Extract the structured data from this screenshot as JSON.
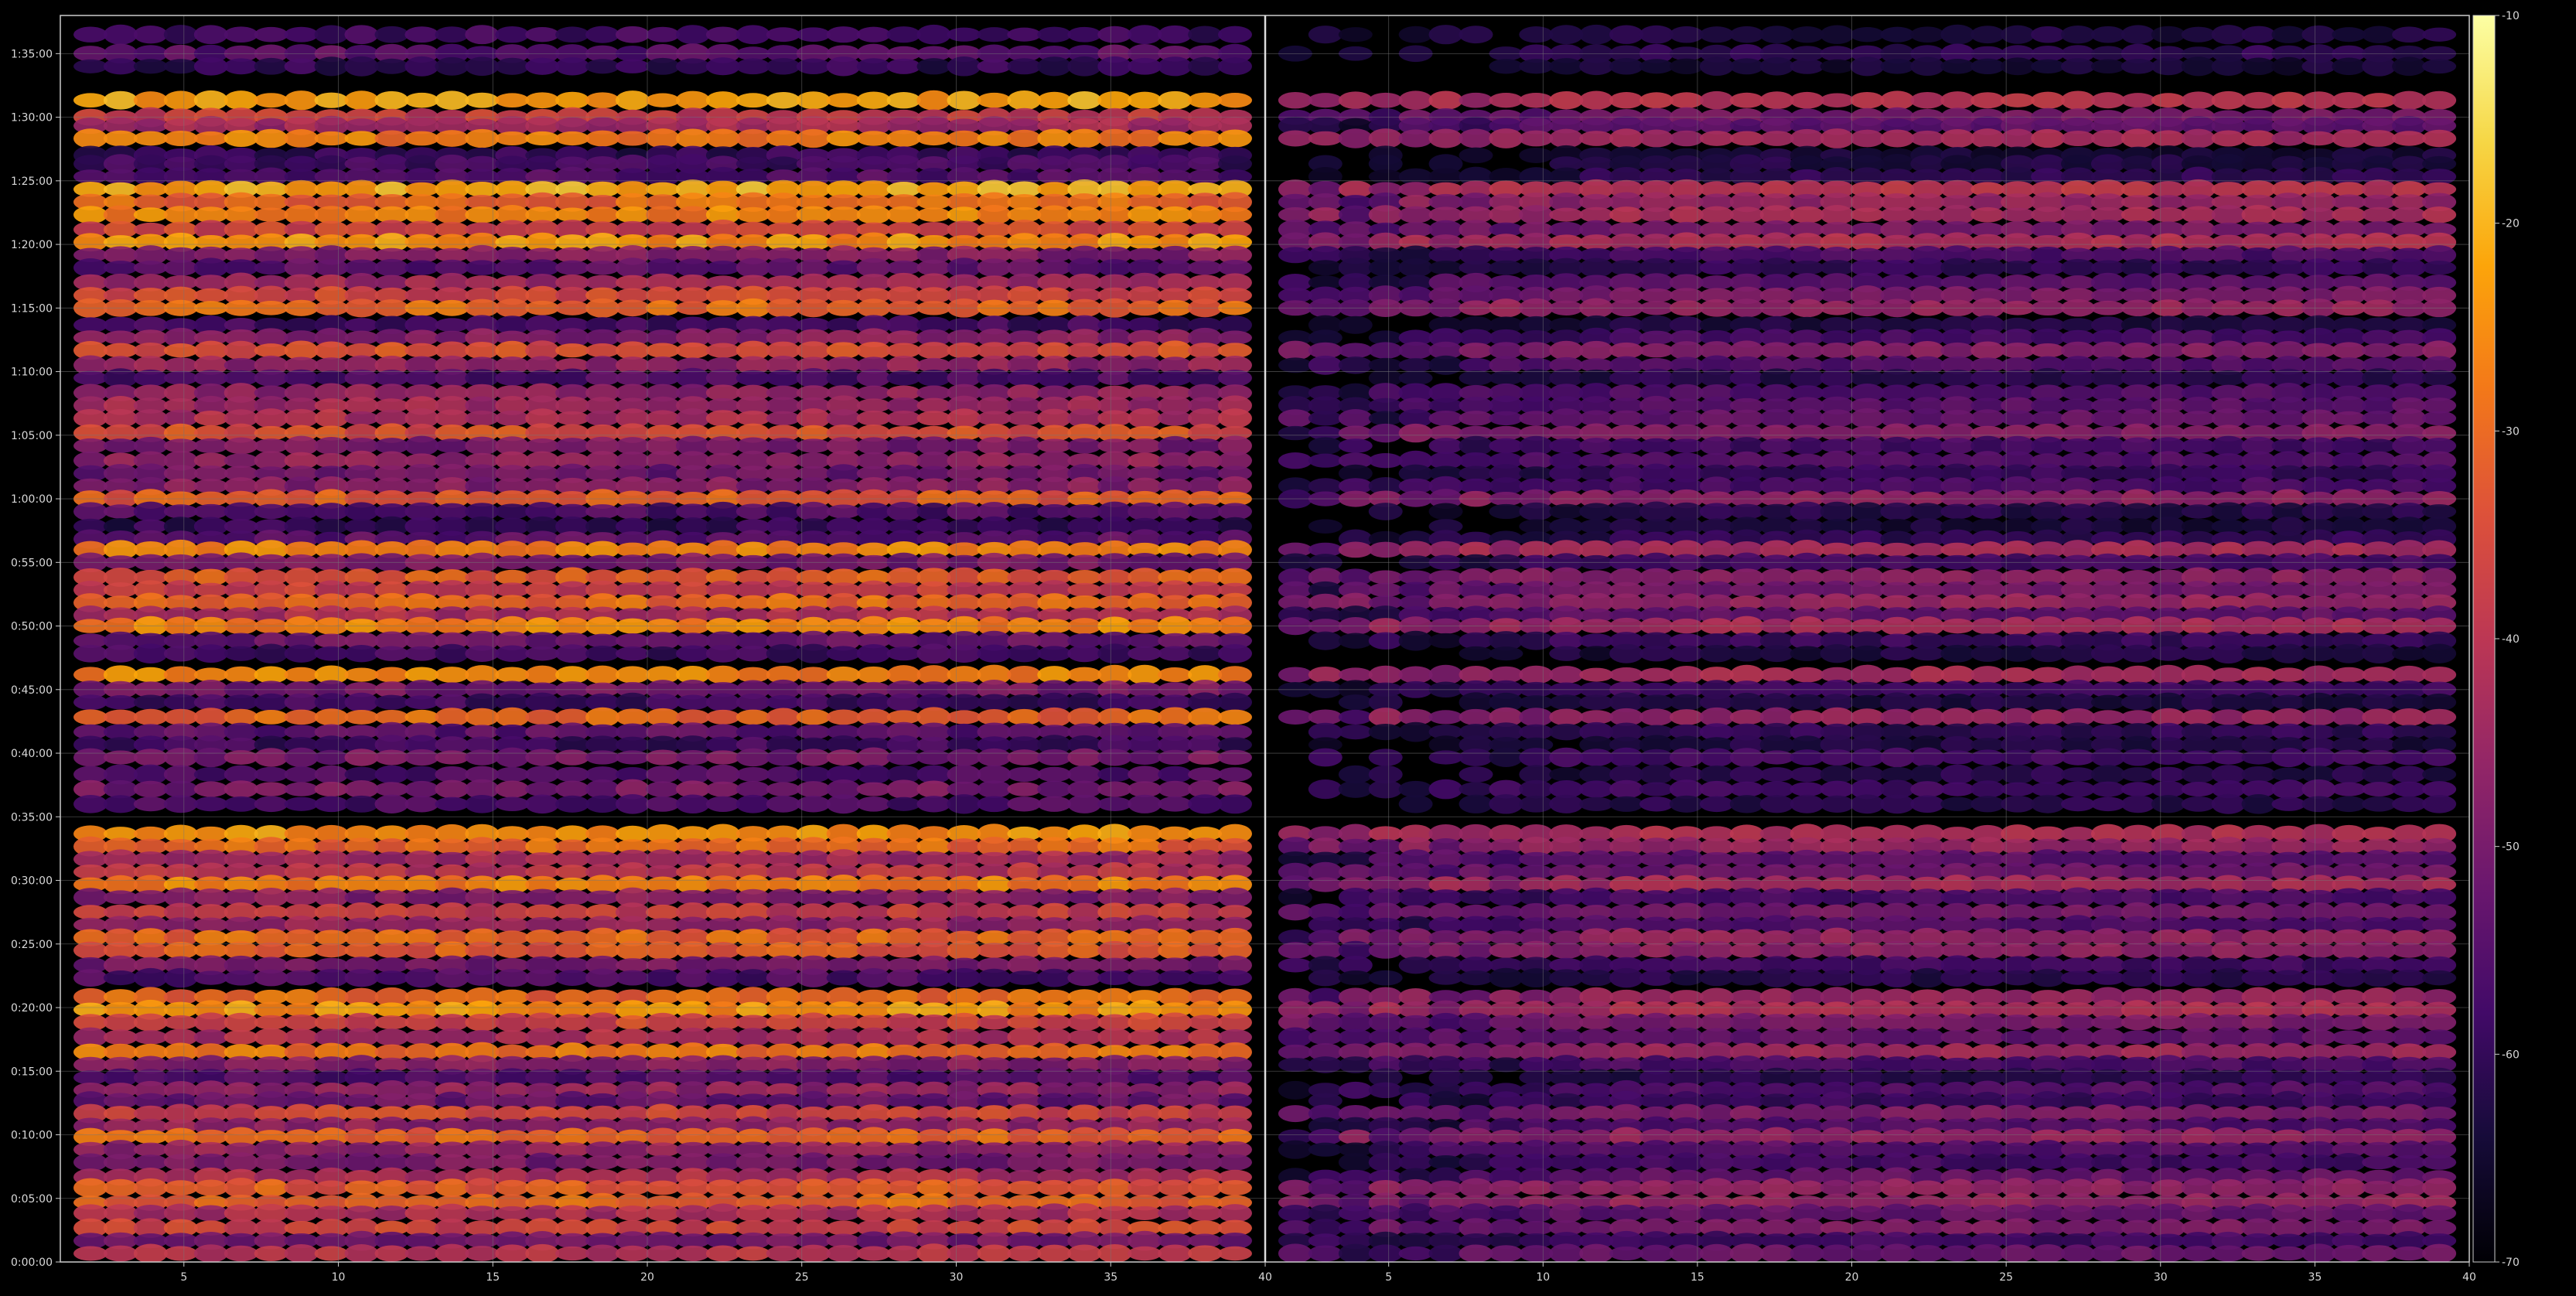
{
  "chart_data": {
    "type": "heatmap",
    "title": "",
    "xlabel": "",
    "ylabel": "",
    "colormap": "inferno",
    "background_color": "#000000",
    "frame_color": "#cccccc",
    "grid": true,
    "grid_color": "#777777",
    "panels": [
      {
        "name": "left",
        "x_range": [
          1,
          40
        ],
        "x_ticks": [
          5,
          10,
          15,
          20,
          25,
          30,
          35,
          40
        ],
        "intensity_scale": 1.0
      },
      {
        "name": "right",
        "x_range": [
          1,
          40
        ],
        "x_ticks": [
          5,
          10,
          15,
          20,
          25,
          30,
          35,
          40
        ],
        "intensity_scale": 0.62
      }
    ],
    "y_range_seconds": [
      0,
      5880
    ],
    "y_ticks": [
      {
        "seconds": 0,
        "label": "0:00:00"
      },
      {
        "seconds": 300,
        "label": "0:05:00"
      },
      {
        "seconds": 600,
        "label": "0:10:00"
      },
      {
        "seconds": 900,
        "label": "0:15:00"
      },
      {
        "seconds": 1200,
        "label": "0:20:00"
      },
      {
        "seconds": 1500,
        "label": "0:25:00"
      },
      {
        "seconds": 1800,
        "label": "0:30:00"
      },
      {
        "seconds": 2100,
        "label": "0:35:00"
      },
      {
        "seconds": 2400,
        "label": "0:40:00"
      },
      {
        "seconds": 2700,
        "label": "0:45:00"
      },
      {
        "seconds": 3000,
        "label": "0:50:00"
      },
      {
        "seconds": 3300,
        "label": "0:55:00"
      },
      {
        "seconds": 3600,
        "label": "1:00:00"
      },
      {
        "seconds": 3900,
        "label": "1:05:00"
      },
      {
        "seconds": 4200,
        "label": "1:10:00"
      },
      {
        "seconds": 4500,
        "label": "1:15:00"
      },
      {
        "seconds": 4800,
        "label": "1:20:00"
      },
      {
        "seconds": 5100,
        "label": "1:25:00"
      },
      {
        "seconds": 5400,
        "label": "1:30:00"
      },
      {
        "seconds": 5700,
        "label": "1:35:00"
      }
    ],
    "rows": [
      {
        "t": 5790,
        "db": -58
      },
      {
        "t": 5700,
        "db": -54
      },
      {
        "t": 5640,
        "db": -60
      },
      {
        "t": 5480,
        "db": -22
      },
      {
        "t": 5400,
        "db": -38
      },
      {
        "t": 5360,
        "db": -44
      },
      {
        "t": 5300,
        "db": -27
      },
      {
        "t": 5220,
        "db": -60
      },
      {
        "t": 5180,
        "db": -58
      },
      {
        "t": 5120,
        "db": -55
      },
      {
        "t": 5060,
        "db": -21
      },
      {
        "t": 5000,
        "db": -30
      },
      {
        "t": 4940,
        "db": -26
      },
      {
        "t": 4870,
        "db": -36
      },
      {
        "t": 4810,
        "db": -24
      },
      {
        "t": 4750,
        "db": -48
      },
      {
        "t": 4690,
        "db": -54
      },
      {
        "t": 4620,
        "db": -44
      },
      {
        "t": 4560,
        "db": -36
      },
      {
        "t": 4500,
        "db": -30
      },
      {
        "t": 4420,
        "db": -58
      },
      {
        "t": 4360,
        "db": -48
      },
      {
        "t": 4300,
        "db": -34
      },
      {
        "t": 4230,
        "db": -46
      },
      {
        "t": 4170,
        "db": -56
      },
      {
        "t": 4100,
        "db": -46
      },
      {
        "t": 4040,
        "db": -44
      },
      {
        "t": 3980,
        "db": -42
      },
      {
        "t": 3910,
        "db": -34
      },
      {
        "t": 3850,
        "db": -50
      },
      {
        "t": 3780,
        "db": -46
      },
      {
        "t": 3720,
        "db": -52
      },
      {
        "t": 3660,
        "db": -48
      },
      {
        "t": 3600,
        "db": -32
      },
      {
        "t": 3540,
        "db": -56
      },
      {
        "t": 3470,
        "db": -60
      },
      {
        "t": 3410,
        "db": -54
      },
      {
        "t": 3360,
        "db": -26
      },
      {
        "t": 3300,
        "db": -50
      },
      {
        "t": 3230,
        "db": -32
      },
      {
        "t": 3170,
        "db": -38
      },
      {
        "t": 3110,
        "db": -30
      },
      {
        "t": 3050,
        "db": -42
      },
      {
        "t": 3000,
        "db": -26
      },
      {
        "t": 2930,
        "db": -52
      },
      {
        "t": 2870,
        "db": -58
      },
      {
        "t": 2770,
        "db": -26
      },
      {
        "t": 2700,
        "db": -50
      },
      {
        "t": 2640,
        "db": -58
      },
      {
        "t": 2570,
        "db": -30
      },
      {
        "t": 2500,
        "db": -54
      },
      {
        "t": 2440,
        "db": -58
      },
      {
        "t": 2380,
        "db": -50
      },
      {
        "t": 2300,
        "db": -56
      },
      {
        "t": 2230,
        "db": -50
      },
      {
        "t": 2160,
        "db": -56
      },
      {
        "t": 2020,
        "db": -24
      },
      {
        "t": 1960,
        "db": -30
      },
      {
        "t": 1900,
        "db": -44
      },
      {
        "t": 1840,
        "db": -40
      },
      {
        "t": 1780,
        "db": -26
      },
      {
        "t": 1720,
        "db": -48
      },
      {
        "t": 1650,
        "db": -38
      },
      {
        "t": 1590,
        "db": -46
      },
      {
        "t": 1530,
        "db": -30
      },
      {
        "t": 1470,
        "db": -32
      },
      {
        "t": 1400,
        "db": -50
      },
      {
        "t": 1340,
        "db": -56
      },
      {
        "t": 1250,
        "db": -30
      },
      {
        "t": 1190,
        "db": -24
      },
      {
        "t": 1130,
        "db": -36
      },
      {
        "t": 1060,
        "db": -42
      },
      {
        "t": 990,
        "db": -28
      },
      {
        "t": 930,
        "db": -48
      },
      {
        "t": 870,
        "db": -56
      },
      {
        "t": 810,
        "db": -46
      },
      {
        "t": 760,
        "db": -52
      },
      {
        "t": 700,
        "db": -36
      },
      {
        "t": 640,
        "db": -46
      },
      {
        "t": 590,
        "db": -30
      },
      {
        "t": 530,
        "db": -46
      },
      {
        "t": 470,
        "db": -50
      },
      {
        "t": 400,
        "db": -42
      },
      {
        "t": 350,
        "db": -32
      },
      {
        "t": 280,
        "db": -30
      },
      {
        "t": 230,
        "db": -42
      },
      {
        "t": 160,
        "db": -36
      },
      {
        "t": 100,
        "db": -50
      },
      {
        "t": 40,
        "db": -40
      }
    ],
    "colorbar": {
      "range": [
        -70,
        -10
      ],
      "ticks": [
        {
          "value": -10,
          "label": "-10"
        },
        {
          "value": -20,
          "label": "-20"
        },
        {
          "value": -30,
          "label": "-30"
        },
        {
          "value": -40,
          "label": "-40"
        },
        {
          "value": -50,
          "label": "-50"
        },
        {
          "value": -60,
          "label": "-60"
        },
        {
          "value": -70,
          "label": "-70"
        }
      ]
    }
  }
}
